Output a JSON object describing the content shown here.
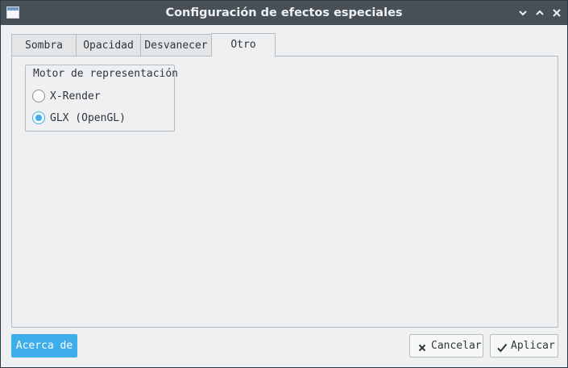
{
  "window": {
    "title": "Configuración de efectos especiales"
  },
  "tabs": [
    {
      "label": "Sombra"
    },
    {
      "label": "Opacidad"
    },
    {
      "label": "Desvanecer"
    },
    {
      "label": "Otro"
    }
  ],
  "active_tab": "Otro",
  "group": {
    "title": "Motor de representación",
    "options": [
      {
        "label": "X-Render",
        "checked": false
      },
      {
        "label": "GLX (OpenGL)",
        "checked": true
      }
    ]
  },
  "buttons": {
    "about": "Acerca de",
    "cancel": "Cancelar",
    "apply": "Aplicar"
  },
  "colors": {
    "titlebar": "#475057",
    "accent": "#3daee9",
    "background": "#eff0f1"
  },
  "icons": {
    "app": "window-icon",
    "minimize": "minimize-icon",
    "maximize": "maximize-icon",
    "close": "close-icon",
    "cancel": "x-icon",
    "apply": "checkmark-icon"
  }
}
